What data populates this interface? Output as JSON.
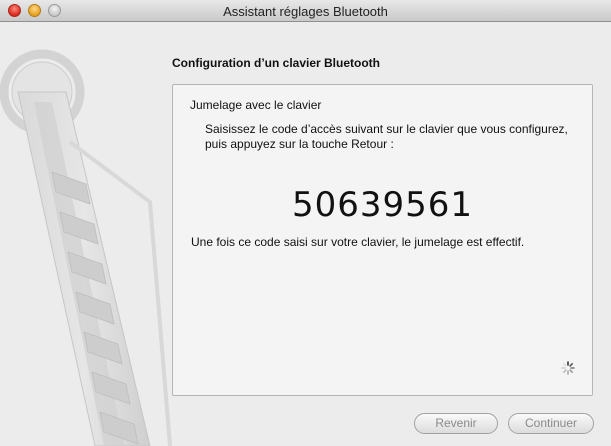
{
  "window": {
    "title": "Assistant réglages Bluetooth"
  },
  "heading": "Configuration d’un clavier Bluetooth",
  "panel": {
    "title": "Jumelage avec le clavier",
    "instruction": "Saisissez le code d’accès suivant sur le clavier que vous configurez, puis appuyez sur la touche Retour :",
    "passkey": "50639561",
    "result": "Une fois ce code saisi sur votre clavier, le jumelage est effectif."
  },
  "buttons": {
    "back_label": "Revenir",
    "continue_label": "Continuer"
  },
  "icons": {
    "close": "close-icon",
    "minimize": "minimize-icon",
    "zoom": "zoom-icon",
    "spinner": "spinner-icon",
    "artwork": "bluetooth-assistant-artwork"
  }
}
